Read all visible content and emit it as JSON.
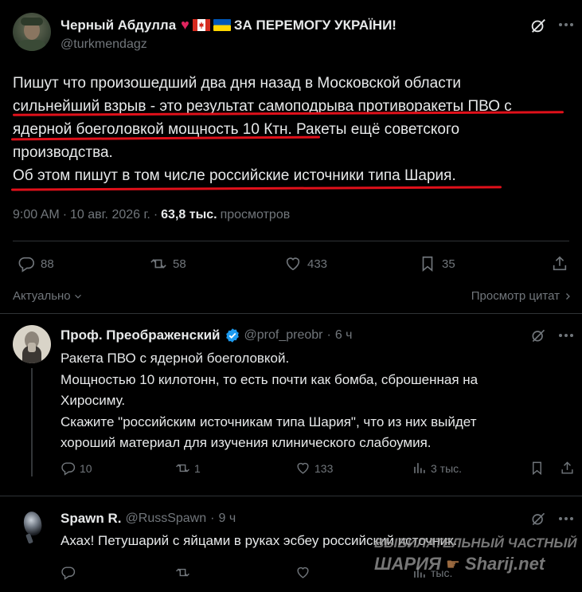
{
  "main_tweet": {
    "display_name": "Черный Абдулла",
    "name_suffix": "ЗА ПЕРЕМОГУ УКРАЇНИ!",
    "handle": "@turkmendagz",
    "text_lines": [
      "Пишут что произошедший два дня назад в Московской области",
      "сильнейший взрыв - это результат самоподрыва противоракеты ПВО с",
      "ядерной боеголовкой мощность 10 Ктн. Ракеты ещё советского",
      "производства.",
      "Об этом пишут в том числе российские источники типа Шария."
    ],
    "time": "9:00 AM",
    "date": "10 авг. 2026 г.",
    "sep": "·",
    "views_count": "63,8 тыс.",
    "views_label": "просмотров",
    "replies": "88",
    "reposts": "58",
    "likes": "433",
    "bookmarks": "35"
  },
  "sort_bar": {
    "sort_label": "Актуально",
    "quotes_label": "Просмотр цитат"
  },
  "reply1": {
    "display_name": "Проф. Преображенский",
    "handle": "@prof_preobr",
    "time": "6 ч",
    "text_lines": [
      "Ракета ПВО с ядерной боеголовкой.",
      "Мощностью 10 килотонн, то есть почти как бомба, сброшенная на",
      "Хиросиму.",
      "Скажите \"российским источникам типа Шария\", что из них выйдет",
      "хороший материал для изучения клинического слабоумия."
    ],
    "replies": "10",
    "reposts": "1",
    "likes": "133",
    "views": "3 тыс."
  },
  "reply2": {
    "display_name": "Spawn R.",
    "handle": "@RussSpawn",
    "time": "9 ч",
    "text": "Ахах! Петушарий с яйцами в руках эсбеу российский источник."
  },
  "watermark": {
    "line1": "ВЫБИЛАТЕЛЬНЫЙ ЧАСТНЫЙ",
    "line2_left": "ШАРИЯ",
    "line2_right": "Sharij.net",
    "small": "тыс."
  },
  "colors": {
    "background": "#000000",
    "text": "#e7e9ea",
    "muted": "#71767b",
    "underline": "#e0101a",
    "verified": "#1d9bf0"
  }
}
